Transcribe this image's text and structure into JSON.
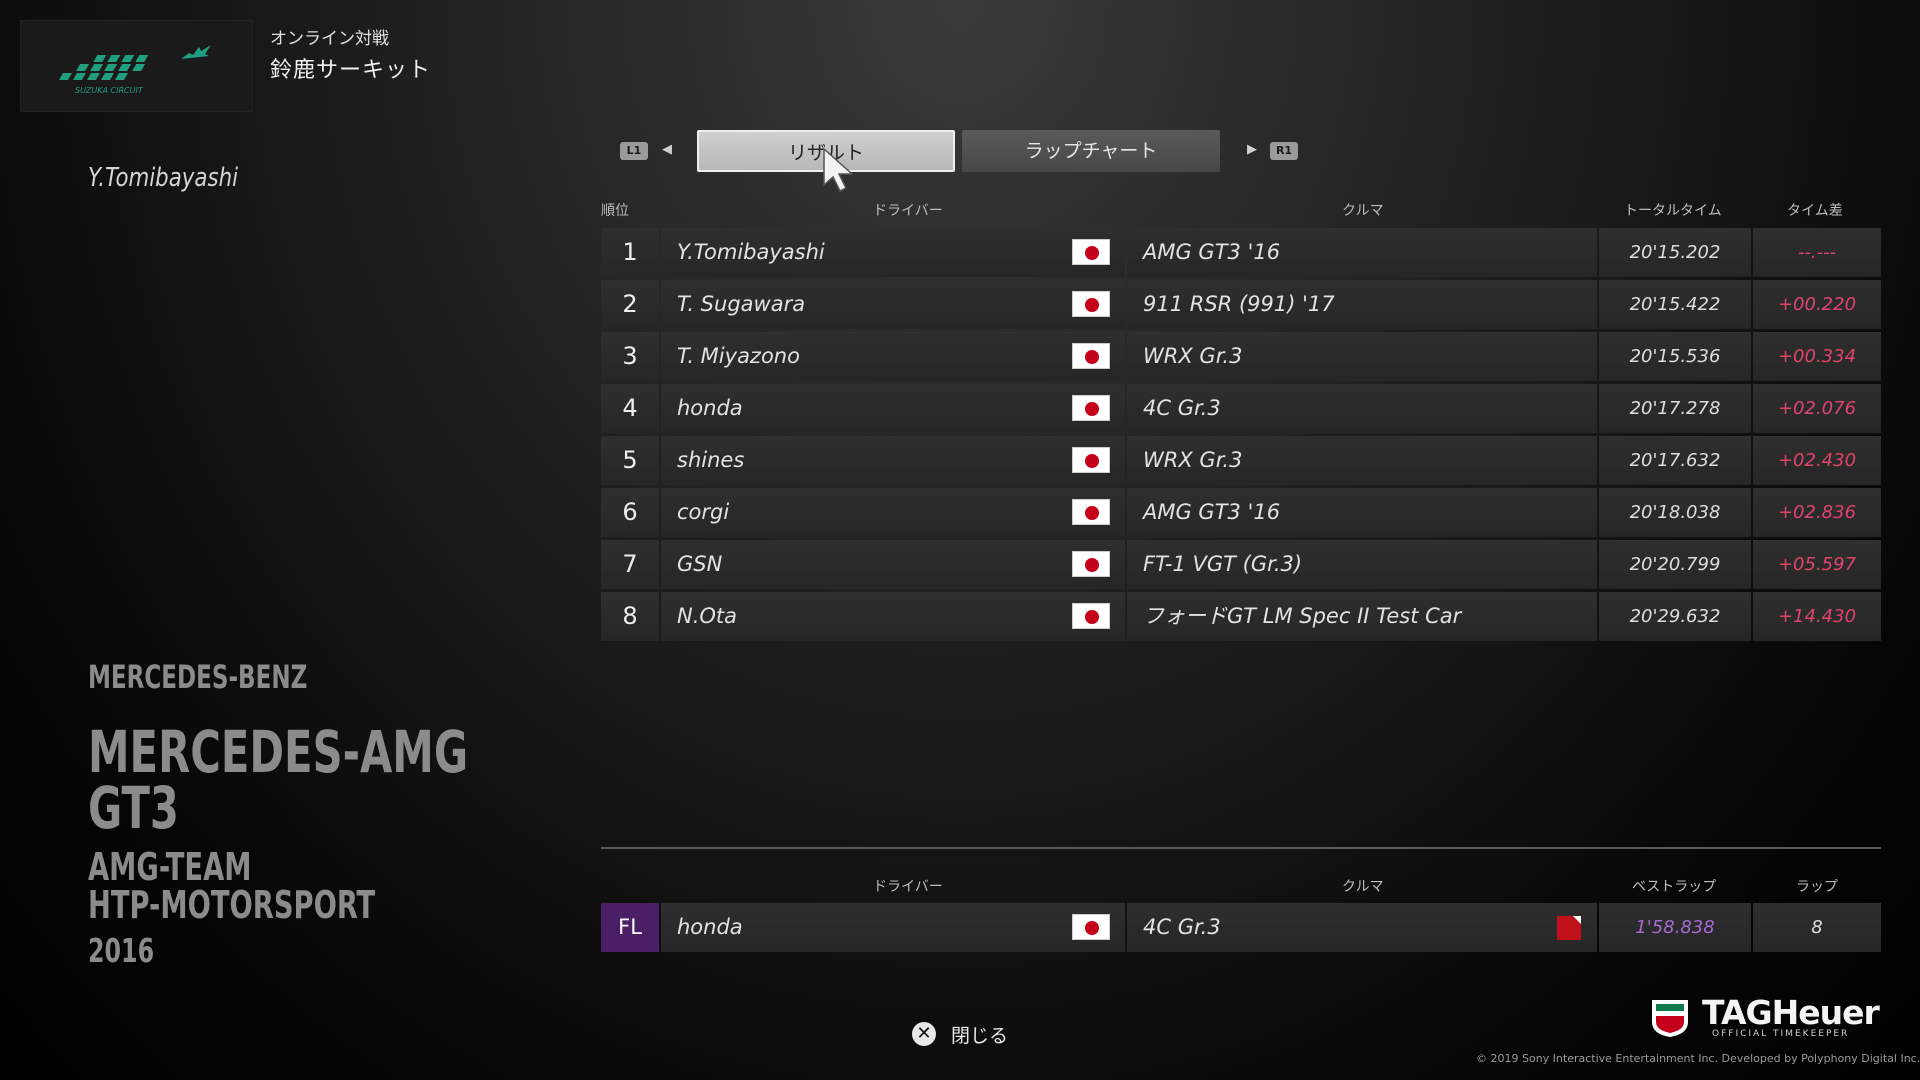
{
  "header": {
    "event_mode": "オンライン対戦",
    "circuit_name": "鈴鹿サーキット",
    "logo_text": "SUZUKA CIRCUIT"
  },
  "player": {
    "name": "Y.Tomibayashi"
  },
  "car_info": {
    "maker": "MERCEDES-BENZ",
    "model_line1": "MERCEDES-AMG",
    "model_line2": "GT3",
    "team_line1": "AMG-TEAM",
    "team_line2": "HTP-MOTORSPORT",
    "year": "2016"
  },
  "tabs": {
    "left_button": "L1",
    "right_button": "R1",
    "result": "リザルト",
    "lap_chart": "ラップチャート",
    "active": "result"
  },
  "results_table": {
    "headers": {
      "position": "順位",
      "driver": "ドライバー",
      "car": "クルマ",
      "total_time": "トータルタイム",
      "gap": "タイム差"
    },
    "rows": [
      {
        "pos": "1",
        "driver": "Y.Tomibayashi",
        "car": "AMG GT3 '16",
        "time": "20'15.202",
        "gap": "--.---"
      },
      {
        "pos": "2",
        "driver": "T. Sugawara",
        "car": "911 RSR (991) '17",
        "time": "20'15.422",
        "gap": "+00.220"
      },
      {
        "pos": "3",
        "driver": "T. Miyazono",
        "car": "WRX Gr.3",
        "time": "20'15.536",
        "gap": "+00.334"
      },
      {
        "pos": "4",
        "driver": "honda",
        "car": "4C Gr.3",
        "time": "20'17.278",
        "gap": "+02.076"
      },
      {
        "pos": "5",
        "driver": "shines",
        "car": "WRX Gr.3",
        "time": "20'17.632",
        "gap": "+02.430"
      },
      {
        "pos": "6",
        "driver": "corgi",
        "car": "AMG GT3 '16",
        "time": "20'18.038",
        "gap": "+02.836"
      },
      {
        "pos": "7",
        "driver": "GSN",
        "car": "FT-1 VGT (Gr.3)",
        "time": "20'20.799",
        "gap": "+05.597"
      },
      {
        "pos": "8",
        "driver": "N.Ota",
        "car": "フォードGT LM Spec II Test Car",
        "time": "20'29.632",
        "gap": "+14.430"
      }
    ]
  },
  "fastest_lap": {
    "headers": {
      "driver": "ドライバー",
      "car": "クルマ",
      "best_lap": "ベストラップ",
      "lap": "ラップ"
    },
    "label": "FL",
    "driver": "honda",
    "car": "4C Gr.3",
    "best_lap": "1'58.838",
    "lap": "8"
  },
  "footer": {
    "close_label": "閉じる",
    "sponsor": "TAGHeuer",
    "sponsor_sub": "OFFICIAL TIMEKEEPER",
    "copyright": "© 2019 Sony Interactive Entertainment Inc. Developed by Polyphony Digital Inc."
  },
  "colors": {
    "gap_red": "#e0446a",
    "fastest_purple": "#a66ad0",
    "fl_badge": "#4b1f66",
    "flag_red": "#c4001b"
  }
}
